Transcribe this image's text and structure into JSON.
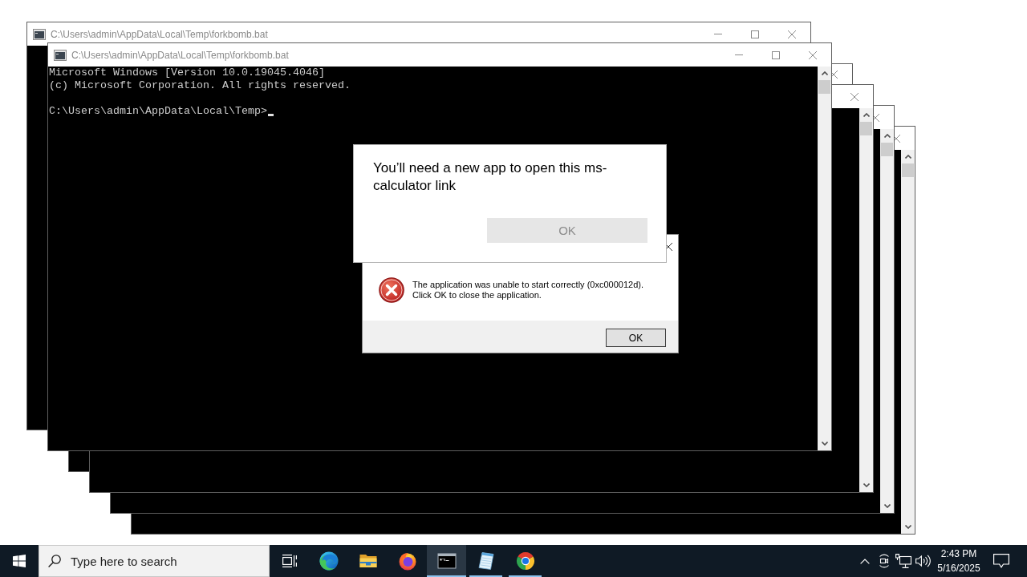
{
  "console_windows": [
    {
      "title": "C:\\Users\\admin\\AppData\\Local\\Temp\\forkbomb.bat"
    },
    {
      "title": "C:\\Users\\admin\\AppData\\Local\\Temp\\forkbomb.bat",
      "banner": [
        "Microsoft Windows [Version 10.0.19045.4046]",
        "(c) Microsoft Corporation. All rights reserved."
      ],
      "prompt": "C:\\Users\\admin\\AppData\\Local\\Temp>"
    }
  ],
  "app_dialog": {
    "message": "You’ll need a new app to open this ms-calculator link",
    "button": {
      "label": "OK",
      "disabled": true
    }
  },
  "error_dialog": {
    "message": "The application was unable to start correctly (0xc000012d). Click OK to close the application.",
    "button": "OK"
  },
  "taskbar": {
    "search": {
      "placeholder": "Type here to search"
    },
    "apps": [
      {
        "kind": "edge",
        "running": false,
        "active": false
      },
      {
        "kind": "explorer",
        "running": false,
        "active": false
      },
      {
        "kind": "firefox",
        "running": false,
        "active": false
      },
      {
        "kind": "terminal",
        "running": true,
        "active": true
      },
      {
        "kind": "notepad",
        "running": true,
        "active": false
      },
      {
        "kind": "chrome",
        "running": true,
        "active": false
      }
    ],
    "clock": {
      "time": "2:43 PM",
      "date": "5/16/2025"
    }
  }
}
